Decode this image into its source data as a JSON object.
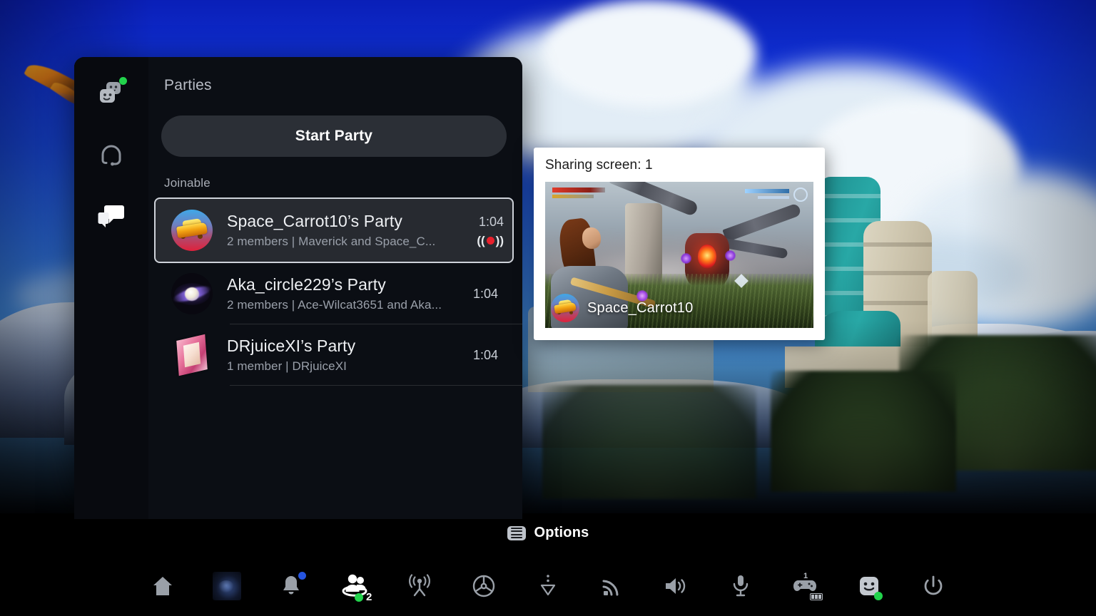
{
  "rail": {
    "items": [
      {
        "name": "game-base",
        "icon": "people-faces-icon",
        "badge": "online-dot"
      },
      {
        "name": "voice-chat",
        "icon": "headset-icon",
        "badge": null
      },
      {
        "name": "messages",
        "icon": "chat-bubbles-icon",
        "badge": null,
        "active": true
      }
    ]
  },
  "panel": {
    "title": "Parties",
    "start_party_label": "Start Party",
    "section_label": "Joinable"
  },
  "parties": [
    {
      "name": "Space_Carrot10’s Party",
      "subtitle": "2 members | Maverick and Space_C...",
      "time": "1:04",
      "avatar": "car-avatar",
      "selected": true,
      "broadcasting": true
    },
    {
      "name": "Aka_circle229’s Party",
      "subtitle": "2 members | Ace-Wilcat3651 and Aka...",
      "time": "1:04",
      "avatar": "planet-avatar",
      "selected": false,
      "broadcasting": false
    },
    {
      "name": "DRjuiceXI’s Party",
      "subtitle": "1 member | DRjuiceXI",
      "time": "1:04",
      "avatar": "frame-avatar",
      "selected": false,
      "broadcasting": false
    }
  ],
  "share_card": {
    "title": "Sharing screen: 1",
    "user_name": "Space_Carrot10"
  },
  "options": {
    "label": "Options",
    "icon": "options-button-icon"
  },
  "taskbar": {
    "items": [
      {
        "name": "home",
        "icon": "home-icon"
      },
      {
        "name": "game-switcher",
        "icon": "game-thumbnail-icon"
      },
      {
        "name": "notifications",
        "icon": "bell-icon",
        "badge_color": "#2554e0"
      },
      {
        "name": "game-base",
        "icon": "people-group-icon",
        "count": "2",
        "badge_color": "#22d34c"
      },
      {
        "name": "broadcast",
        "icon": "broadcast-icon"
      },
      {
        "name": "accessibility",
        "icon": "accessibility-icon"
      },
      {
        "name": "downloads",
        "icon": "downloads-icon"
      },
      {
        "name": "network",
        "icon": "wifi-icon"
      },
      {
        "name": "sound",
        "icon": "speaker-icon"
      },
      {
        "name": "microphone",
        "icon": "microphone-icon"
      },
      {
        "name": "accessories",
        "icon": "controller-battery-icon",
        "controller_number": "1"
      },
      {
        "name": "profile",
        "icon": "avatar-face-icon",
        "badge_color": "#22d34c"
      },
      {
        "name": "power",
        "icon": "power-icon"
      }
    ]
  },
  "colors": {
    "accent_green": "#22d34c",
    "accent_blue": "#2554e0",
    "record_red": "#e8202c",
    "panel_bg": "#0b0e14",
    "selected_row_bg": "#272a30"
  }
}
